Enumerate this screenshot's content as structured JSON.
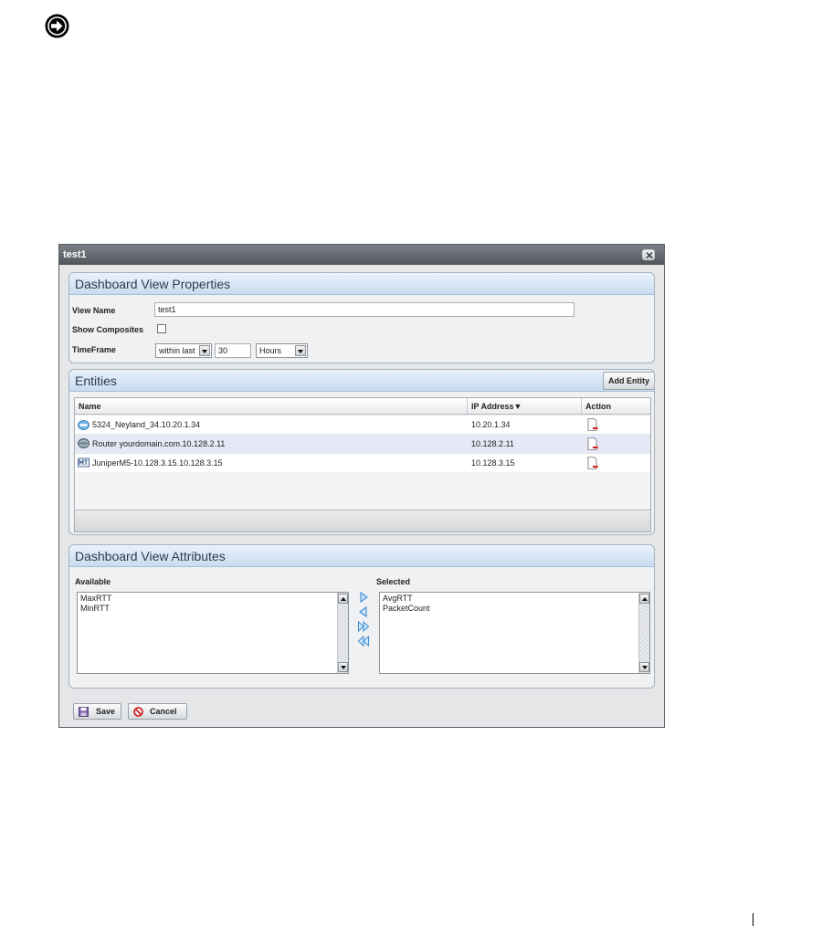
{
  "note_icon": "arrow-right-circle-icon",
  "window": {
    "title": "test1",
    "close_icon": "close-icon",
    "properties": {
      "header": "Dashboard View Properties",
      "view_name_label": "View Name",
      "view_name_value": "test1",
      "show_composites_label": "Show Composites",
      "show_composites_checked": false,
      "timeframe_label": "TimeFrame",
      "timeframe_mode": "within last",
      "timeframe_amount": "30",
      "timeframe_unit": "Hours"
    },
    "entities": {
      "header": "Entities",
      "add_button": "Add Entity",
      "columns": [
        "Name",
        "IP Address",
        "Action"
      ],
      "sort_indicator": "▼",
      "rows": [
        {
          "icon": "dell-switch-icon",
          "name": "5324_Neyland_34.10.20.1.34",
          "ip": "10.20.1.34",
          "action_icon": "remove-document-icon"
        },
        {
          "icon": "router-globe-icon",
          "name": "Router yourdomain.com.10.128.2.11",
          "ip": "10.128.2.11",
          "action_icon": "remove-document-icon"
        },
        {
          "icon": "juniper-device-icon",
          "name": "JuniperM5-10.128.3.15.10.128.3.15",
          "ip": "10.128.3.15",
          "action_icon": "remove-document-icon"
        }
      ]
    },
    "attributes": {
      "header": "Dashboard View Attributes",
      "available_label": "Available",
      "selected_label": "Selected",
      "available": [
        "MaxRTT",
        "MinRTT"
      ],
      "selected": [
        "AvgRTT",
        "PacketCount"
      ]
    },
    "buttons": {
      "save": "Save",
      "cancel": "Cancel"
    }
  },
  "colors": {
    "panel_header": "#c8dcf0",
    "titlebar": "#50555b",
    "selected_row": "#e6e8f5",
    "arrow_blue": "#3d8fd8"
  }
}
